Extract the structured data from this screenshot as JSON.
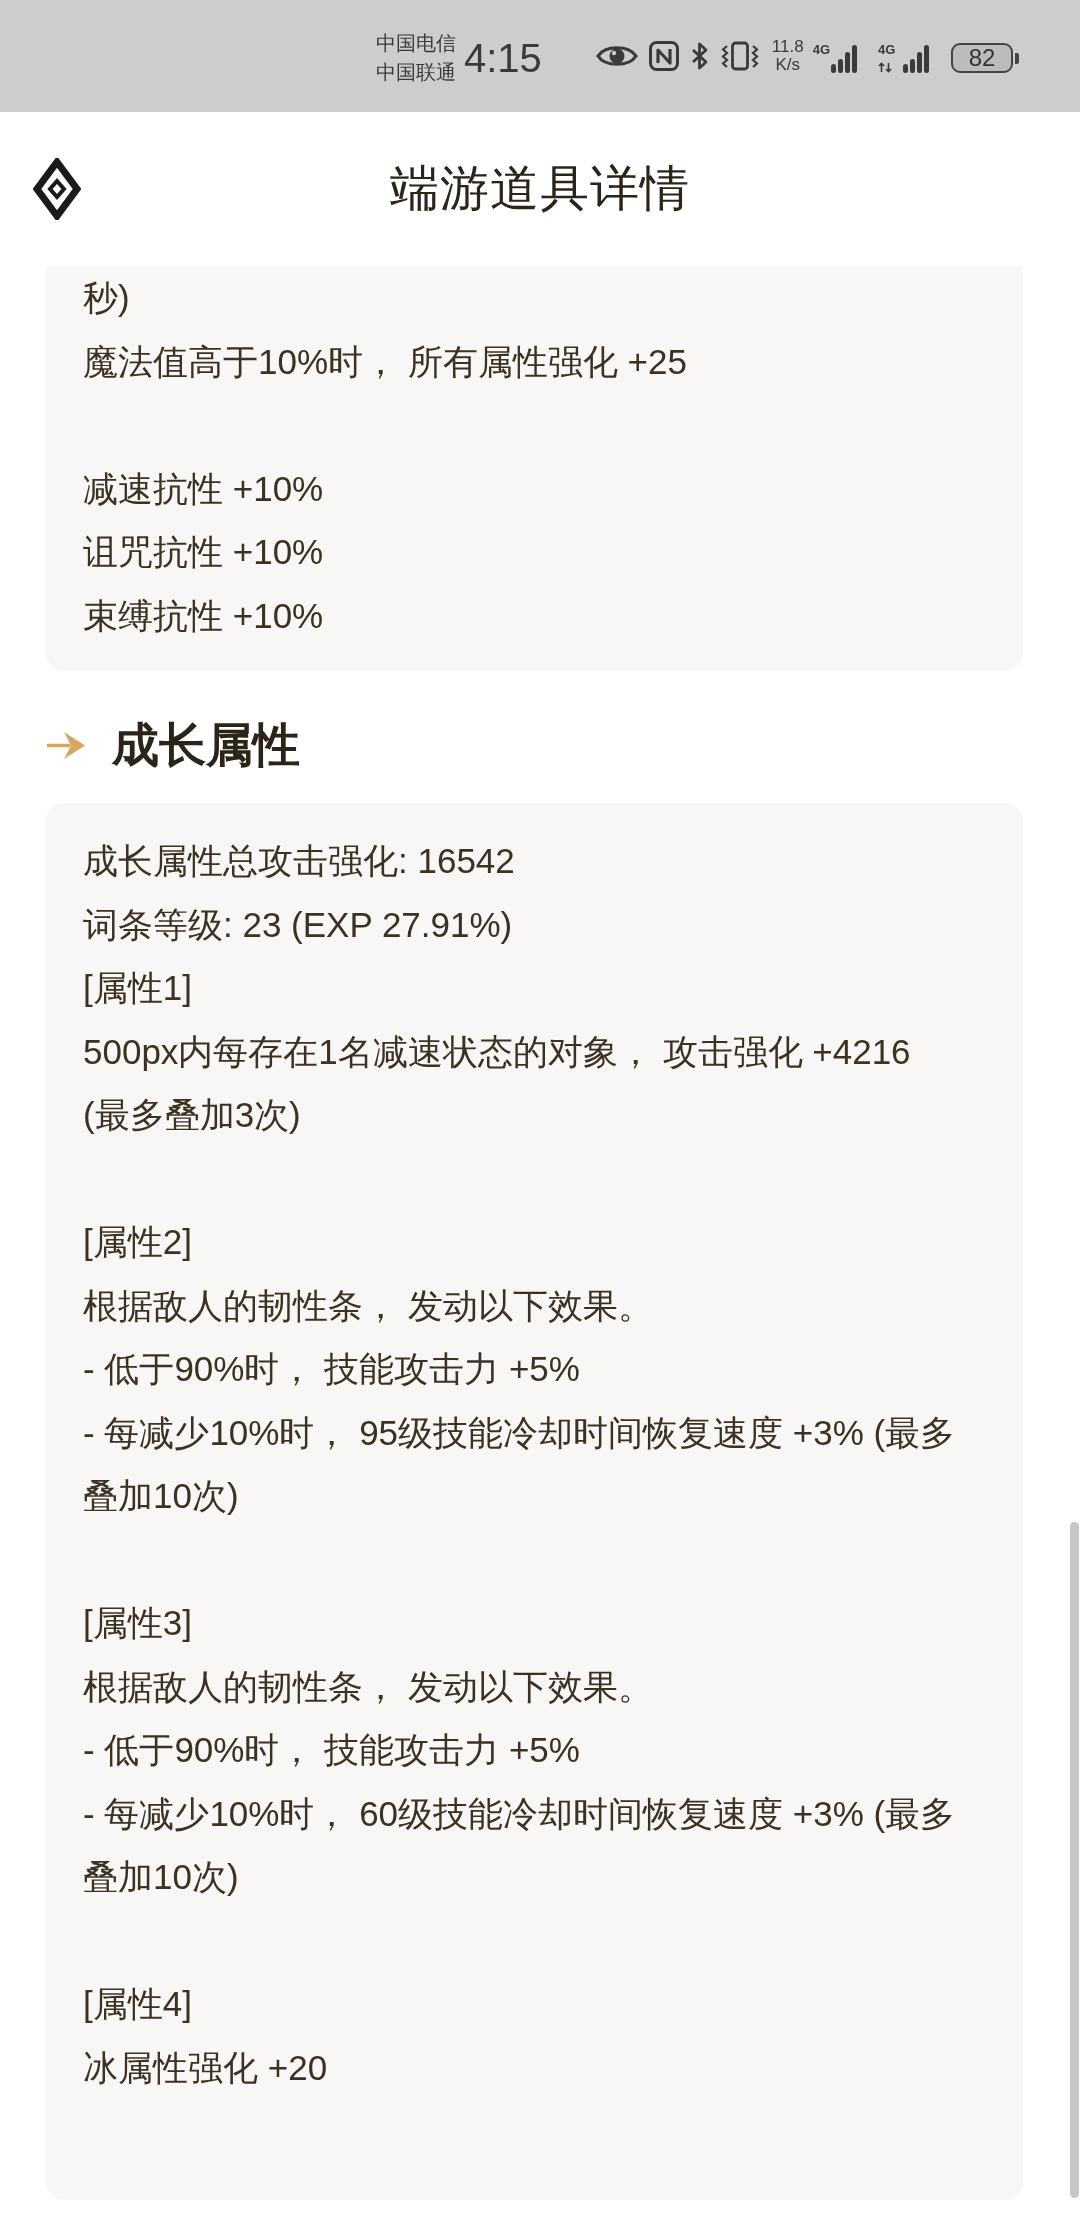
{
  "status_bar": {
    "carriers": [
      "中国电信",
      "中国联通"
    ],
    "time": "4:15",
    "net_speed": {
      "value": "11.8",
      "unit": "K/s"
    },
    "signals": [
      {
        "label": "4G",
        "activity": false
      },
      {
        "label": "4G",
        "activity": true
      }
    ],
    "battery": "82"
  },
  "header": {
    "title": "端游道具详情"
  },
  "sections": [
    {
      "kind": "partial_card",
      "paragraphs": [
        [
          "秒)",
          "魔法值高于10%时， 所有属性强化 +25"
        ],
        [
          "减速抗性 +10%",
          "诅咒抗性 +10%",
          "束缚抗性 +10%"
        ]
      ]
    },
    {
      "kind": "heading",
      "title": "成长属性"
    },
    {
      "kind": "card",
      "paragraphs": [
        [
          "成长属性总攻击强化: 16542",
          "词条等级: 23 (EXP 27.91%)",
          "[属性1]",
          "500px内每存在1名减速状态的对象， 攻击强化 +4216",
          "(最多叠加3次)"
        ],
        [
          "[属性2]",
          "根据敌人的韧性条， 发动以下效果。",
          "- 低于90%时， 技能攻击力 +5%",
          "- 每减少10%时， 95级技能冷却时间恢复速度 +3% (最多叠加10次)"
        ],
        [
          "[属性3]",
          "根据敌人的韧性条， 发动以下效果。",
          "- 低于90%时， 技能攻击力 +5%",
          "- 每减少10%时， 60级技能冷却时间恢复速度 +3% (最多叠加10次)"
        ],
        [
          "[属性4]",
          "冰属性强化 +20"
        ]
      ]
    }
  ]
}
